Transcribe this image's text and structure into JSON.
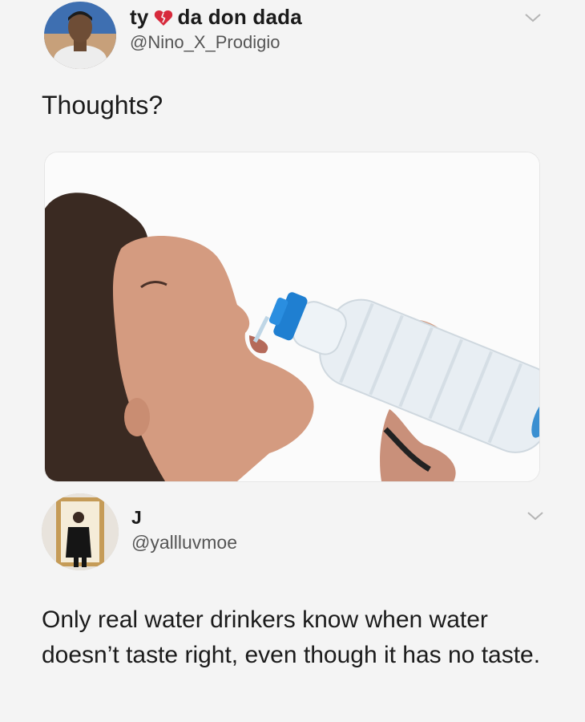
{
  "tweet": {
    "display_name_part1": "ty",
    "heart_icon": "broken-heart-icon",
    "display_name_part2": "da don dada",
    "handle": "@Nino_X_Prodigio",
    "text": "Thoughts?",
    "menu_icon": "chevron-down-icon",
    "media_icon": "photo-woman-drinking-water-bottle"
  },
  "reply": {
    "display_name": "J",
    "handle": "@yallluvmoe",
    "text": "Only real water drinkers know when water doesn’t taste right, even though it has no taste.",
    "menu_icon": "chevron-down-icon"
  },
  "colors": {
    "background": "#f4f4f4",
    "text": "#1b1b1b",
    "handle": "#555555",
    "heart": "#d72a3c",
    "chevron": "#b5b5b5",
    "bottle_cap": "#1f7fd1"
  }
}
